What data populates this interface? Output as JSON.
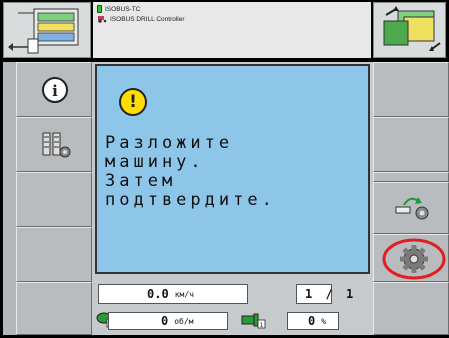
{
  "header": {
    "task_controller_label": "ISOBUS-TC",
    "implement_label": "ISOBUS DRILL Controller"
  },
  "dialog": {
    "warning_symbol": "!",
    "message": "Разложите\nмашину.\nЗатем\nподтвердите."
  },
  "status": {
    "speed_value": "0.0",
    "speed_unit": "км/ч",
    "page_current": "1",
    "page_separator": "/",
    "page_total": "1",
    "rpm_value": "0",
    "rpm_unit": "об/м",
    "percent_value": "0",
    "percent_unit": "%",
    "rpm_index": "1",
    "fan_index": "1"
  },
  "left_softkeys": [
    {
      "icon": "info-icon"
    },
    {
      "icon": "seed-settings-icon"
    },
    {
      "icon": "empty"
    },
    {
      "icon": "empty"
    },
    {
      "icon": "empty"
    }
  ],
  "right_softkeys": [
    {
      "icon": "empty"
    },
    {
      "icon": "empty"
    },
    {
      "icon": "empty"
    },
    {
      "icon": "unfold-settings-icon"
    },
    {
      "icon": "gear-icon",
      "highlighted": true
    },
    {
      "icon": "empty"
    }
  ],
  "colors": {
    "dialog_bg": "#8ec6ea",
    "warning_yellow": "#ffdd00",
    "highlight_red": "#e02020",
    "button_gray": "#b8bcbe"
  }
}
